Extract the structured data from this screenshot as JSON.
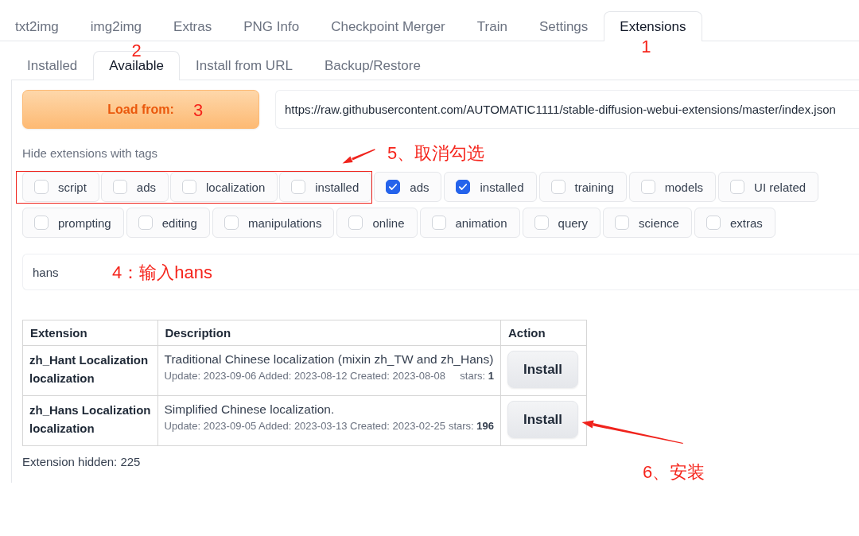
{
  "main_tabs": [
    {
      "label": "txt2img",
      "selected": false
    },
    {
      "label": "img2img",
      "selected": false
    },
    {
      "label": "Extras",
      "selected": false
    },
    {
      "label": "PNG Info",
      "selected": false
    },
    {
      "label": "Checkpoint Merger",
      "selected": false
    },
    {
      "label": "Train",
      "selected": false
    },
    {
      "label": "Settings",
      "selected": false
    },
    {
      "label": "Extensions",
      "selected": true,
      "annotation": "1"
    }
  ],
  "sub_tabs": [
    {
      "label": "Installed",
      "selected": false
    },
    {
      "label": "Available",
      "selected": true,
      "annotation": "2"
    },
    {
      "label": "Install from URL",
      "selected": false
    },
    {
      "label": "Backup/Restore",
      "selected": false
    }
  ],
  "load_button": {
    "label": "Load from:",
    "annotation": "3"
  },
  "url_field": {
    "value": "https://raw.githubusercontent.com/AUTOMATIC1111/stable-diffusion-webui-extensions/master/index.json"
  },
  "tag_filter": {
    "label": "Hide extensions with tags",
    "groups": [
      {
        "highlighted": true,
        "annotation": "5、取消勾选",
        "tags": [
          {
            "label": "script",
            "checked": false
          },
          {
            "label": "ads",
            "checked": false
          },
          {
            "label": "localization",
            "checked": false
          },
          {
            "label": "installed",
            "checked": false
          }
        ]
      },
      {
        "highlighted": false,
        "tags": [
          {
            "label": "ads",
            "checked": true
          },
          {
            "label": "installed",
            "checked": true
          },
          {
            "label": "training",
            "checked": false
          },
          {
            "label": "models",
            "checked": false
          },
          {
            "label": "UI related",
            "checked": false
          },
          {
            "label": "prompting",
            "checked": false
          },
          {
            "label": "editing",
            "checked": false
          },
          {
            "label": "manipulations",
            "checked": false
          },
          {
            "label": "online",
            "checked": false
          },
          {
            "label": "animation",
            "checked": false
          },
          {
            "label": "query",
            "checked": false
          },
          {
            "label": "science",
            "checked": false
          },
          {
            "label": "extras",
            "checked": false
          }
        ]
      }
    ]
  },
  "search_field": {
    "value": "hans",
    "annotation": "4：输入hans"
  },
  "table": {
    "columns": [
      "Extension",
      "Description",
      "Action"
    ],
    "rows": [
      {
        "name": "zh_Hant Localization",
        "tags": "localization",
        "description": "Traditional Chinese localization (mixin zh_TW and zh_Hans)",
        "info": "Update: 2023-09-06 Added: 2023-08-12 Created: 2023-08-08",
        "stars_text": "stars: **1**",
        "action": "Install"
      },
      {
        "name": "zh_Hans Localization",
        "tags": "localization",
        "description": "Simplified Chinese localization.",
        "info": "Update: 2023-09-05 Added: 2023-03-13 Created: 2023-02-25",
        "stars_text": "stars: **196**",
        "action": "Install",
        "annotation": "6、安装"
      }
    ]
  },
  "hidden_count": "Extension hidden: 225"
}
